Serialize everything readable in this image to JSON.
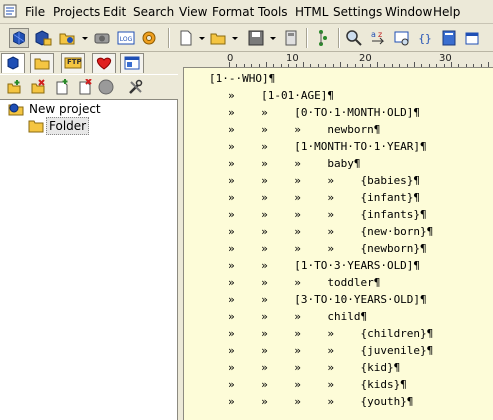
{
  "menu": [
    "File",
    "Projects",
    "Edit",
    "Search",
    "View",
    "Format",
    "Tools",
    "HTML",
    "Settings",
    "Window",
    "Help"
  ],
  "toolbar_icons": [
    "sphere-blue-icon",
    "sphere-open-icon",
    "project-open-icon",
    "camera-icon",
    "log-icon",
    "gear-icon",
    "new-document-icon",
    "open-folder-icon",
    "save-icon",
    "save-all-icon",
    "tree-icon",
    "find-icon",
    "replace-icon",
    "preview-icon",
    "code-braces-icon",
    "book-icon",
    "external-window-icon"
  ],
  "left_tabs": [
    "project-tab",
    "files-tab",
    "ftp-tab",
    "favorites-tab",
    "templates-tab"
  ],
  "ftp_label": "FTP",
  "left_toolbar_icons": [
    "add-icon",
    "remove-icon",
    "new-file-icon",
    "settings-icon",
    "disc-icon",
    "tools-icon"
  ],
  "tree": {
    "project": "New project",
    "folder": "Folder"
  },
  "ruler": {
    "numbers": [
      "0",
      "10",
      "20",
      "30"
    ]
  },
  "editor": {
    "lines": [
      "[1·-·WHO]¶",
      "»    [1-01·AGE]¶",
      "»    »    [0·TO·1·MONTH·OLD]¶",
      "»    »    »    newborn¶",
      "»    »    [1·MONTH·TO·1·YEAR]¶",
      "»    »    »    baby¶",
      "»    »    »    »    {babies}¶",
      "»    »    »    »    {infant}¶",
      "»    »    »    »    {infants}¶",
      "»    »    »    »    {new·born}¶",
      "»    »    »    »    {newborn}¶",
      "»    »    [1·TO·3·YEARS·OLD]¶",
      "»    »    »    toddler¶",
      "»    »    [3·TO·10·YEARS·OLD]¶",
      "»    »    »    child¶",
      "»    »    »    »    {children}¶",
      "»    »    »    »    {juvenile}¶",
      "»    »    »    »    {kid}¶",
      "»    »    »    »    {kids}¶",
      "»    »    »    »    {youth}¶"
    ]
  },
  "colors": {
    "editor_bg": "#fdfcd8",
    "chrome": "#ece9d8",
    "accent_blue": "#1f4fb5",
    "folder_yellow": "#f4c542"
  }
}
